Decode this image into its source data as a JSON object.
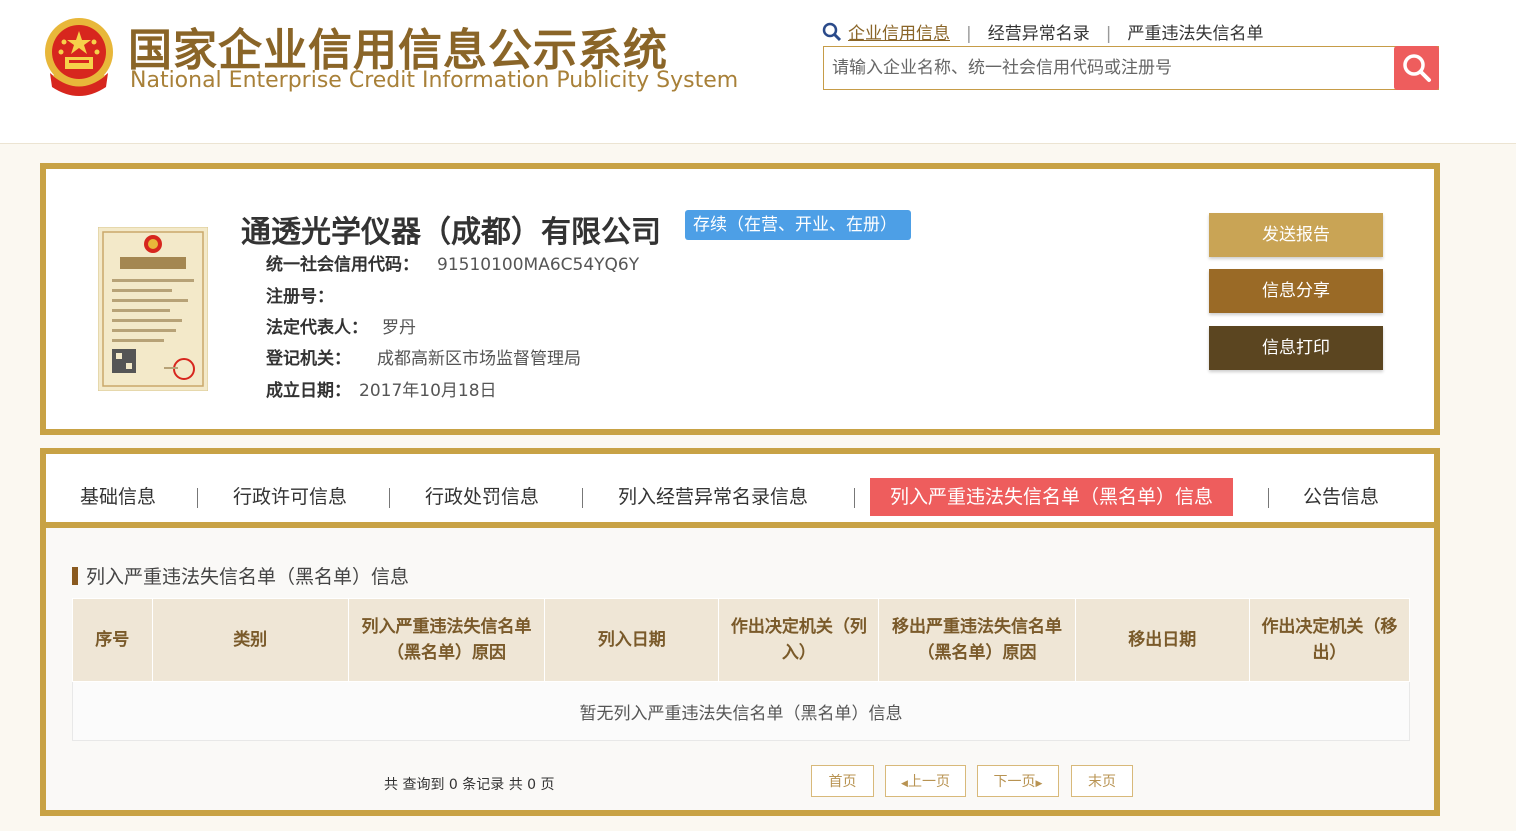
{
  "header": {
    "title_cn": "国家企业信用信息公示系统",
    "title_en": "National Enterprise Credit Information Publicity System",
    "links": [
      "企业信用信息",
      "经营异常名录",
      "严重违法失信名单"
    ],
    "search_placeholder": "请输入企业名称、统一社会信用代码或注册号"
  },
  "company": {
    "name": "通透光学仪器（成都）有限公司",
    "status": "存续（在营、开业、在册）",
    "fields": [
      {
        "label": "统一社会信用代码：",
        "value": "91510100MA6C54YQ6Y"
      },
      {
        "label": "注册号：",
        "value": ""
      },
      {
        "label": "法定代表人：",
        "value": "罗丹"
      },
      {
        "label": "登记机关：",
        "value": "成都高新区市场监督管理局"
      },
      {
        "label": "成立日期：",
        "value": "2017年10月18日"
      }
    ],
    "license_label": "营业执照",
    "buttons": {
      "send": "发送报告",
      "share": "信息分享",
      "print": "信息打印"
    }
  },
  "tabs": [
    "基础信息",
    "行政许可信息",
    "行政处罚信息",
    "列入经营异常名录信息",
    "列入严重违法失信名单（黑名单）信息",
    "公告信息"
  ],
  "section": {
    "title": "列入严重违法失信名单（黑名单）信息",
    "columns": [
      "序号",
      "类别",
      "列入严重违法失信名单（黑名单）原因",
      "列入日期",
      "作出决定机关（列入）",
      "移出严重违法失信名单（黑名单）原因",
      "移出日期",
      "作出决定机关（移出）"
    ],
    "empty_text": "暂无列入严重违法失信名单（黑名单）信息"
  },
  "pager": {
    "info": "共 查询到 0 条记录 共 0 页",
    "first": "首页",
    "prev": "上一页",
    "next": "下一页",
    "last": "末页"
  },
  "colors": {
    "gold": "#c8a245",
    "accent_red": "#ee5d5d",
    "badge_blue": "#4d9fe6"
  }
}
